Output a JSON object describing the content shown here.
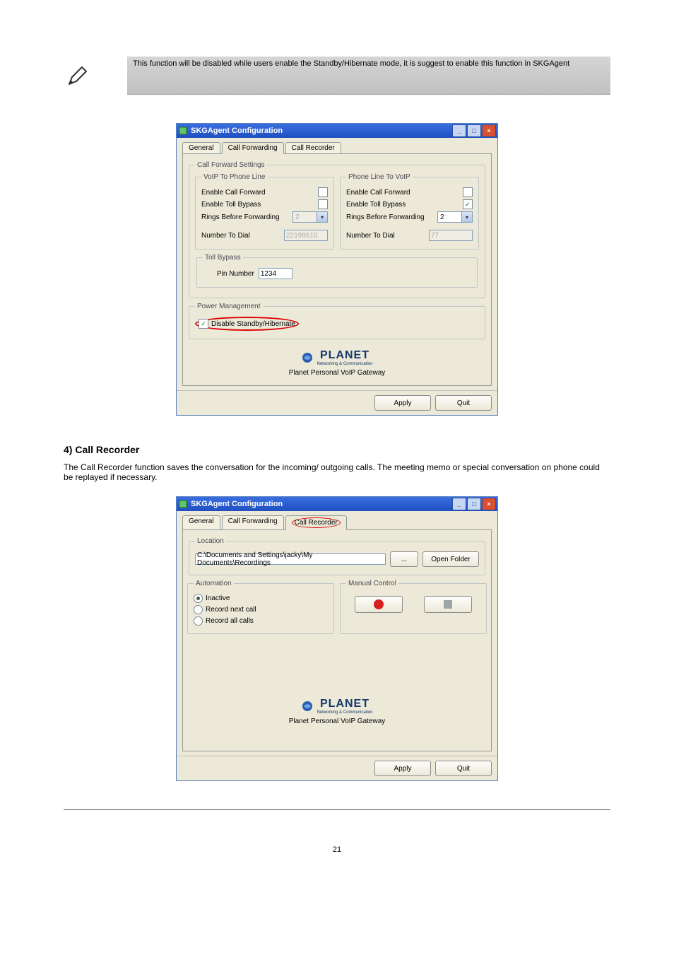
{
  "note_text": "This function will be disabled while users enable the Standby/Hibernate mode, it is suggest to enable this function in SKGAgent",
  "shot1": {
    "titlebar": "SKGAgent Configuration",
    "tabs": {
      "general": "General",
      "forwarding": "Call Forwarding",
      "recorder": "Call Recorder"
    },
    "group_cfs": "Call Forward Settings",
    "voip_to_phone": {
      "legend": "VoIP To Phone Line",
      "enable_forward": "Enable Call Forward",
      "enable_toll": "Enable Toll Bypass",
      "rings_label": "Rings Before Forwarding",
      "rings_value": "2",
      "dial_label": "Number To Dial",
      "dial_value": "22199510"
    },
    "phone_to_voip": {
      "legend": "Phone Line To VoIP",
      "enable_forward": "Enable Call Forward",
      "enable_toll": "Enable Toll Bypass",
      "toll_checked": "✓",
      "rings_label": "Rings Before Forwarding",
      "rings_value": "2",
      "dial_label": "Number To Dial",
      "dial_value": "77"
    },
    "toll_bypass": {
      "legend": "Toll Bypass",
      "pin_label": "Pin Number",
      "pin_value": "1234"
    },
    "power": {
      "legend": "Power Management",
      "disable_label": "Disable Standby/Hibernate"
    },
    "brand_word": "PLANET",
    "brand_sub": "Networking & Communication",
    "brand_caption": "Planet Personal VoIP Gateway",
    "apply": "Apply",
    "quit": "Quit"
  },
  "section_title": "4) Call Recorder",
  "section_text": "The Call Recorder function saves the conversation for the incoming/ outgoing calls. The meeting memo or special conversation on phone could be replayed if necessary.",
  "shot2": {
    "titlebar": "SKGAgent Configuration",
    "tabs": {
      "general": "General",
      "forwarding": "Call Forwarding",
      "recorder": "Call Recorder"
    },
    "location": {
      "legend": "Location",
      "path": "C:\\Documents and Settings\\jacky\\My Documents\\Recordings",
      "browse": "...",
      "open": "Open Folder"
    },
    "automation": {
      "legend": "Automation",
      "inactive": "Inactive",
      "record_next": "Record next call",
      "record_all": "Record all calls"
    },
    "manual": {
      "legend": "Manual Control"
    },
    "brand_word": "PLANET",
    "brand_sub": "Networking & Communication",
    "brand_caption": "Planet Personal VoIP Gateway",
    "apply": "Apply",
    "quit": "Quit"
  },
  "page_num": "21"
}
